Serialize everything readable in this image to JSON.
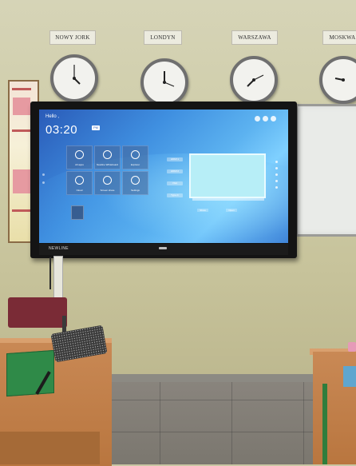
{
  "clocks": {
    "labels": [
      "NOWY JORK",
      "LONDYN",
      "WARSZAWA",
      "MOSKWA"
    ]
  },
  "tv": {
    "brand": "NEWLINE",
    "screen": {
      "greeting": "Hello ,",
      "time": "03:20",
      "badge": "PM",
      "date": "",
      "apps": [
        {
          "label": "All apps",
          "icon": "apps-icon"
        },
        {
          "label": "Newline Whiteboard",
          "icon": "whiteboard-icon"
        },
        {
          "label": "Explorer",
          "icon": "folder-icon"
        },
        {
          "label": "Cloud",
          "icon": "cloud-icon"
        },
        {
          "label": "Screen share",
          "icon": "cast-icon"
        },
        {
          "label": "Settings",
          "icon": "gear-icon"
        }
      ],
      "sources": [
        "HDMI 1",
        "HDMI 2",
        "VGA",
        "Type-C"
      ],
      "preview_buttons": [
        "Show",
        "Open"
      ]
    }
  },
  "colors": {
    "tv_screen": "#3f8fe0",
    "wall": "#cfcda9",
    "desk": "#c98955",
    "folder": "#2f8a48",
    "chair": "#7a2b36"
  }
}
